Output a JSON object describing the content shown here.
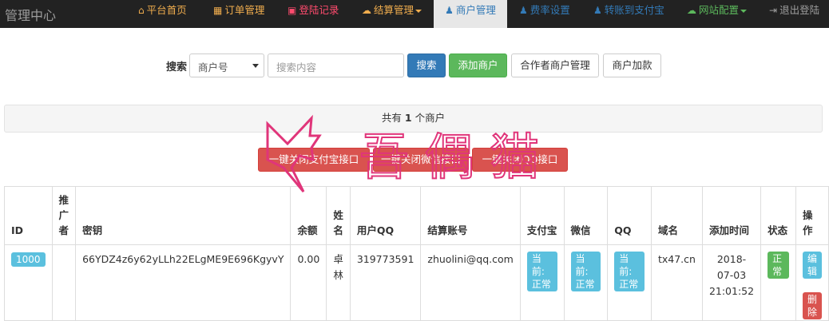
{
  "brand": "管理中心",
  "nav": [
    {
      "icon": "home-icon",
      "glyph": "⌂",
      "label": "平台首页",
      "color": "#f0ad4e"
    },
    {
      "icon": "cart-icon",
      "glyph": "🛒",
      "label": "订单管理",
      "color": "#f0ad4e"
    },
    {
      "icon": "camera-icon",
      "glyph": "▣",
      "label": "登陆记录",
      "color": "#ff4b6e"
    },
    {
      "icon": "cloud-icon",
      "glyph": "☁",
      "label": "结算管理",
      "color": "#f0ad4e"
    },
    {
      "icon": "user-icon",
      "glyph": "👤",
      "label": "商户管理",
      "color": "#337ab7"
    },
    {
      "icon": "user-icon",
      "glyph": "👤",
      "label": "费率设置",
      "color": "#337ab7"
    },
    {
      "icon": "user-icon",
      "glyph": "👤",
      "label": "转账到支付宝",
      "color": "#337ab7"
    },
    {
      "icon": "cloud-icon",
      "glyph": "☁",
      "label": "网站配置",
      "color": "#5cb85c"
    },
    {
      "icon": "logout-icon",
      "glyph": "⎋",
      "label": "退出登陆",
      "color": "#9d9d9d"
    }
  ],
  "search": {
    "label": "搜索",
    "select_value": "商户号",
    "placeholder": "搜索内容",
    "search_button": "搜索",
    "add_button": "添加商户",
    "partner_button": "合作者商户管理",
    "add_funds_button": "商户加款"
  },
  "summary": {
    "prefix": "共有",
    "count": "1",
    "suffix": "个商户"
  },
  "danger_buttons": [
    "一键关闭支付宝接口",
    "一键关闭微信接口",
    "一键关闭QQ接口"
  ],
  "table": {
    "headers": [
      "ID",
      "推广者",
      "密钥",
      "余额",
      "姓名",
      "用户QQ",
      "结算账号",
      "支付宝",
      "微信",
      "QQ",
      "域名",
      "添加时间",
      "状态",
      "操作"
    ],
    "row": {
      "id": "1000",
      "promoter": "",
      "key": "66YDZ4z6y62yLLh22ELgME9E696KgyvY",
      "balance": "0.00",
      "name": "卓林",
      "qq": "319773591",
      "settle": "zhuolini@qq.com",
      "alipay": "当前:正常",
      "wechat": "当前:正常",
      "qqpay": "当前:正常",
      "domain": "tx47.cn",
      "added": "2018-07-03 21:01:52",
      "status": "正常",
      "edit": "编辑",
      "delete": "删除"
    }
  },
  "watermark": {
    "text": "吾爱偶猫",
    "color": "#e0357a"
  }
}
